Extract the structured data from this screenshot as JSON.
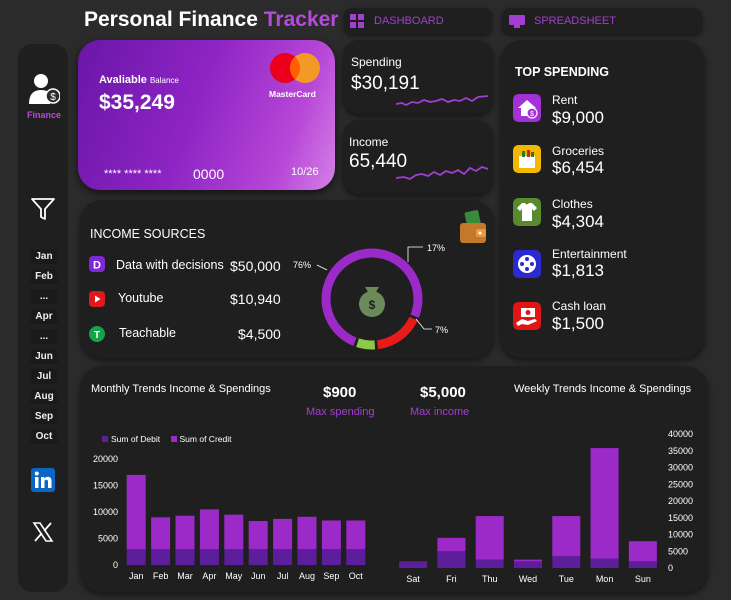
{
  "header": {
    "title_main": "Personal Finance",
    "title_accent": "Tracker",
    "tab_dashboard": "DASHBOARD",
    "tab_spreadsheet": "SPREADSHEET"
  },
  "sidebar": {
    "finance_label": "Finance",
    "months": [
      "Jan",
      "Feb",
      "...",
      "Apr",
      "...",
      "Jun",
      "Jul",
      "Aug",
      "Sep",
      "Oct"
    ]
  },
  "card": {
    "available_label": "Avaliable",
    "balance_label": "Balance",
    "balance": "$35,249",
    "brand": "MasterCard",
    "masked_number": "**** **** ****",
    "last_digits": "0000",
    "expiry": "10/26"
  },
  "spending": {
    "label": "Spending",
    "value": "$30,191"
  },
  "income": {
    "label": "Income",
    "value": "65,440"
  },
  "top_spending": {
    "title": "TOP SPENDING",
    "items": [
      {
        "name": "Rent",
        "value": "$9,000",
        "color": "#a430d8",
        "icon": "house-money-icon"
      },
      {
        "name": "Groceries",
        "value": "$6,454",
        "color": "#f2b800",
        "icon": "grocery-icon"
      },
      {
        "name": "Clothes",
        "value": "$4,304",
        "color": "#5a8a2e",
        "icon": "shirt-icon"
      },
      {
        "name": "Entertainment",
        "value": "$1,813",
        "color": "#2a2ad0",
        "icon": "film-reel-icon"
      },
      {
        "name": "Cash loan",
        "value": "$1,500",
        "color": "#e01515",
        "icon": "cash-hand-icon"
      }
    ]
  },
  "income_sources": {
    "title": "INCOME SOURCES",
    "items": [
      {
        "name": "Data with decisions",
        "value": "$50,000",
        "color": "#7d2ad6",
        "icon": "d-logo-icon"
      },
      {
        "name": "Youtube",
        "value": "$10,940",
        "color": "#e01a1a",
        "icon": "youtube-icon"
      },
      {
        "name": "Teachable",
        "value": "$4,500",
        "color": "#14a34a",
        "icon": "teachable-icon"
      }
    ]
  },
  "donut": {
    "segments": [
      {
        "label": "76%",
        "value": 76,
        "color": "#9b2ac9"
      },
      {
        "label": "17%",
        "value": 17,
        "color": "#e81a1a"
      },
      {
        "label": "7%",
        "value": 7,
        "color": "#8ec84a"
      }
    ]
  },
  "kpis": {
    "max_spending_value": "$900",
    "max_spending_label": "Max spending",
    "max_income_value": "$5,000",
    "max_income_label": "Max  income"
  },
  "chart_data": [
    {
      "type": "bar",
      "title": "Monthly Trends Income & Spendings",
      "categories": [
        "Jan",
        "Feb",
        "Mar",
        "Apr",
        "May",
        "Jun",
        "Jul",
        "Aug",
        "Sep",
        "Oct"
      ],
      "series": [
        {
          "name": "Sum of Debit",
          "values": [
            3000,
            3000,
            3000,
            3000,
            3000,
            3000,
            3000,
            3000,
            3000,
            3000
          ]
        },
        {
          "name": "Sum of Credit",
          "values": [
            14000,
            6000,
            6300,
            7500,
            6500,
            5300,
            5700,
            6100,
            5400,
            5400
          ]
        }
      ],
      "ylim": [
        0,
        20000
      ],
      "yticks": [
        0,
        5000,
        10000,
        15000,
        20000
      ],
      "legend": "top-left",
      "colors": [
        "#5c1e9a",
        "#9b2ac9"
      ]
    },
    {
      "type": "bar",
      "title": "Weekly Trends Income & Spendings",
      "categories": [
        "Sat",
        "Fri",
        "Thu",
        "Wed",
        "Tue",
        "Mon",
        "Sun"
      ],
      "series": [
        {
          "name": "Sum of Debit",
          "values": [
            2000,
            5000,
            2500,
            2000,
            3500,
            2800,
            2000
          ]
        },
        {
          "name": "Sum of Credit",
          "values": [
            0,
            4000,
            13000,
            500,
            12000,
            33000,
            6000
          ]
        }
      ],
      "ylim": [
        0,
        40000
      ],
      "yticks": [
        0,
        5000,
        10000,
        15000,
        20000,
        25000,
        30000,
        35000,
        40000
      ],
      "colors": [
        "#5c1e9a",
        "#9b2ac9"
      ]
    }
  ]
}
